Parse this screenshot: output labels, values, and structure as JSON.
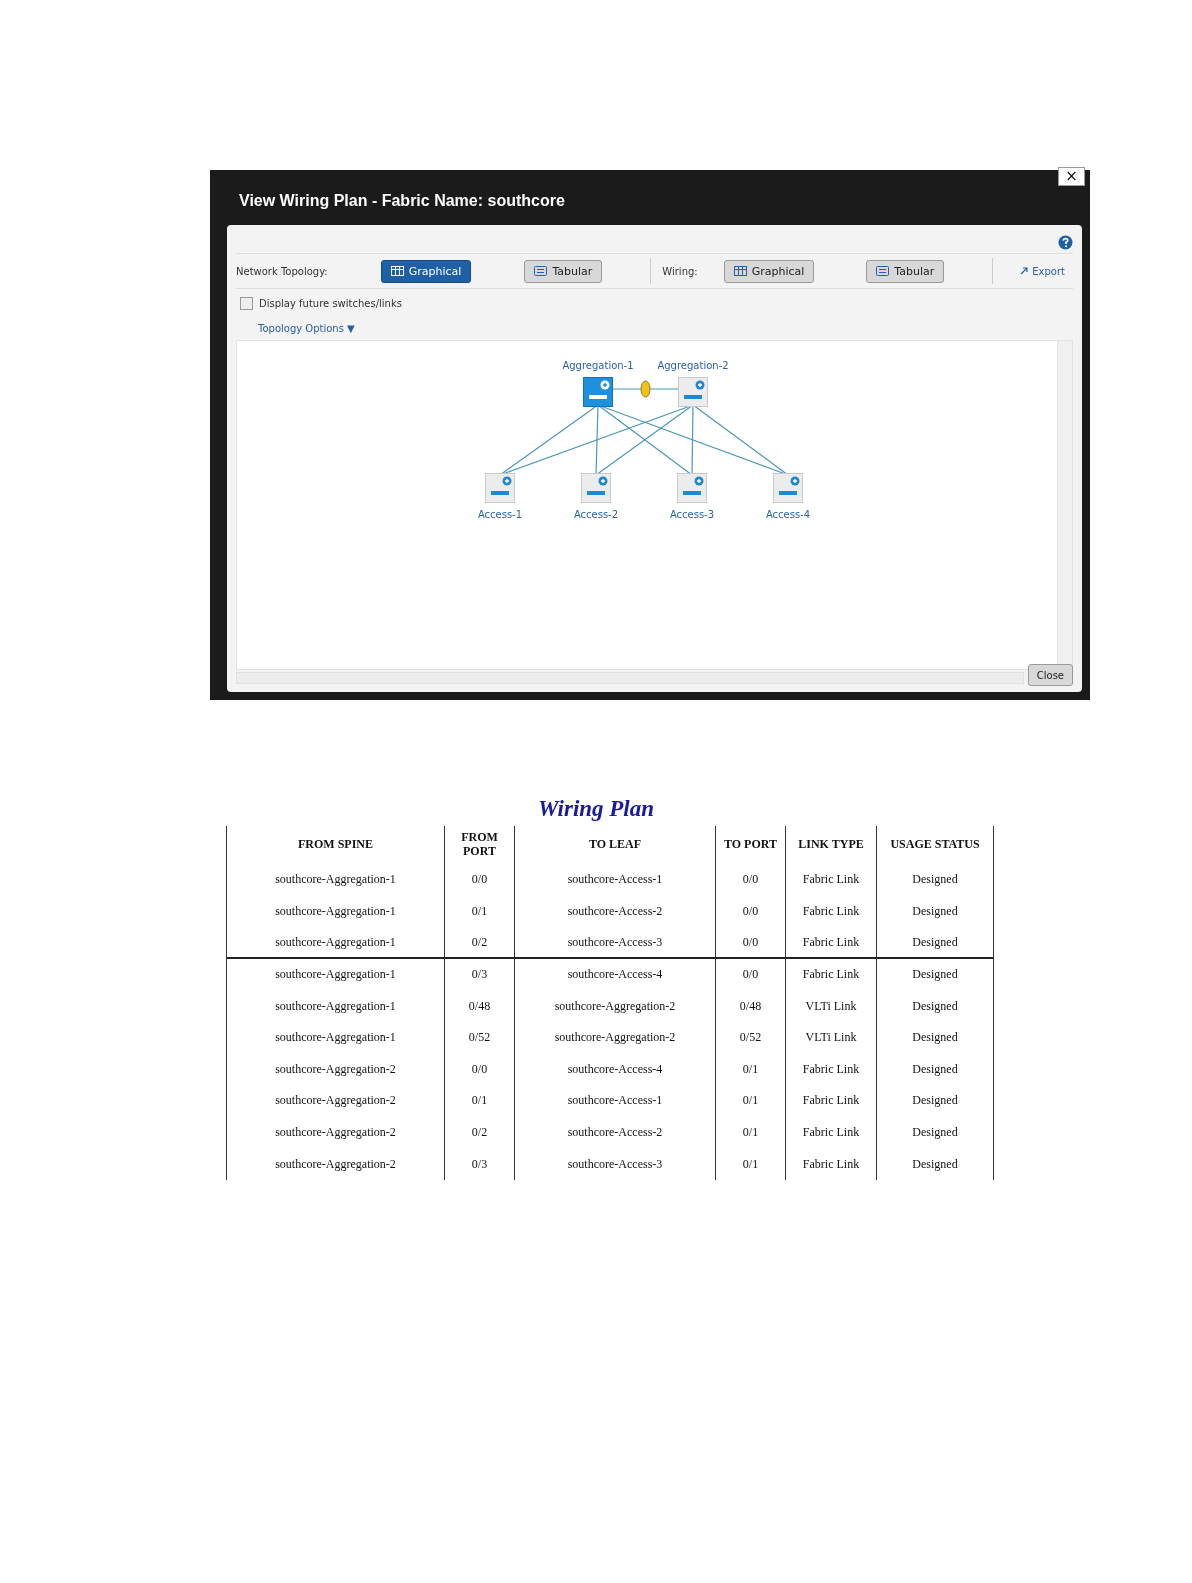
{
  "dialog": {
    "title": "View Wiring Plan - Fabric Name: southcore",
    "close_label": "×",
    "toolbar": {
      "network_topology_label": "Network Topology:",
      "network_topology_buttons": [
        {
          "label": "Graphical",
          "selected": true,
          "kind": "grid"
        },
        {
          "label": "Tabular",
          "selected": false,
          "kind": "list"
        }
      ],
      "wiring_label": "Wiring:",
      "wiring_buttons": [
        {
          "label": "Graphical",
          "selected": false,
          "kind": "grid"
        },
        {
          "label": "Tabular",
          "selected": false,
          "kind": "list"
        }
      ],
      "export_label": "Export"
    },
    "display_future": {
      "label": "Display future switches/links",
      "checked": false
    },
    "topology_options": "Topology Options ▼",
    "nodes": [
      {
        "label": "Aggregation-1",
        "kind": "aggregation",
        "selected": true
      },
      {
        "label": "Aggregation-2",
        "kind": "aggregation",
        "selected": false
      },
      {
        "label": "Access-1",
        "kind": "access",
        "selected": false
      },
      {
        "label": "Access-2",
        "kind": "access",
        "selected": false
      },
      {
        "label": "Access-3",
        "kind": "access",
        "selected": false
      },
      {
        "label": "Access-4",
        "kind": "access",
        "selected": false
      }
    ],
    "close_button": "Close"
  },
  "wiring_plan": {
    "title": "Wiring Plan",
    "columns": [
      "FROM SPINE",
      "FROM PORT",
      "TO LEAF",
      "TO PORT",
      "LINK TYPE",
      "USAGE STATUS"
    ],
    "rows": [
      {
        "cells": [
          "southcore-Aggregation-1",
          "0/0",
          "southcore-Access-1",
          "0/0",
          "Fabric Link",
          "Designed"
        ],
        "rule_below": false
      },
      {
        "cells": [
          "southcore-Aggregation-1",
          "0/1",
          "southcore-Access-2",
          "0/0",
          "Fabric Link",
          "Designed"
        ],
        "rule_below": false
      },
      {
        "cells": [
          "southcore-Aggregation-1",
          "0/2",
          "southcore-Access-3",
          "0/0",
          "Fabric Link",
          "Designed"
        ],
        "rule_below": true
      },
      {
        "cells": [
          "southcore-Aggregation-1",
          "0/3",
          "southcore-Access-4",
          "0/0",
          "Fabric Link",
          "Designed"
        ],
        "rule_below": false
      },
      {
        "cells": [
          "southcore-Aggregation-1",
          "0/48",
          "southcore-Aggregation-2",
          "0/48",
          "VLTi Link",
          "Designed"
        ],
        "rule_below": false
      },
      {
        "cells": [
          "southcore-Aggregation-1",
          "0/52",
          "southcore-Aggregation-2",
          "0/52",
          "VLTi Link",
          "Designed"
        ],
        "rule_below": false
      },
      {
        "cells": [
          "southcore-Aggregation-2",
          "0/0",
          "southcore-Access-4",
          "0/1",
          "Fabric Link",
          "Designed"
        ],
        "rule_below": false
      },
      {
        "cells": [
          "southcore-Aggregation-2",
          "0/1",
          "southcore-Access-1",
          "0/1",
          "Fabric Link",
          "Designed"
        ],
        "rule_below": false
      },
      {
        "cells": [
          "southcore-Aggregation-2",
          "0/2",
          "southcore-Access-2",
          "0/1",
          "Fabric Link",
          "Designed"
        ],
        "rule_below": false
      },
      {
        "cells": [
          "southcore-Aggregation-2",
          "0/3",
          "southcore-Access-3",
          "0/1",
          "Fabric Link",
          "Designed"
        ],
        "rule_below": false
      }
    ]
  }
}
